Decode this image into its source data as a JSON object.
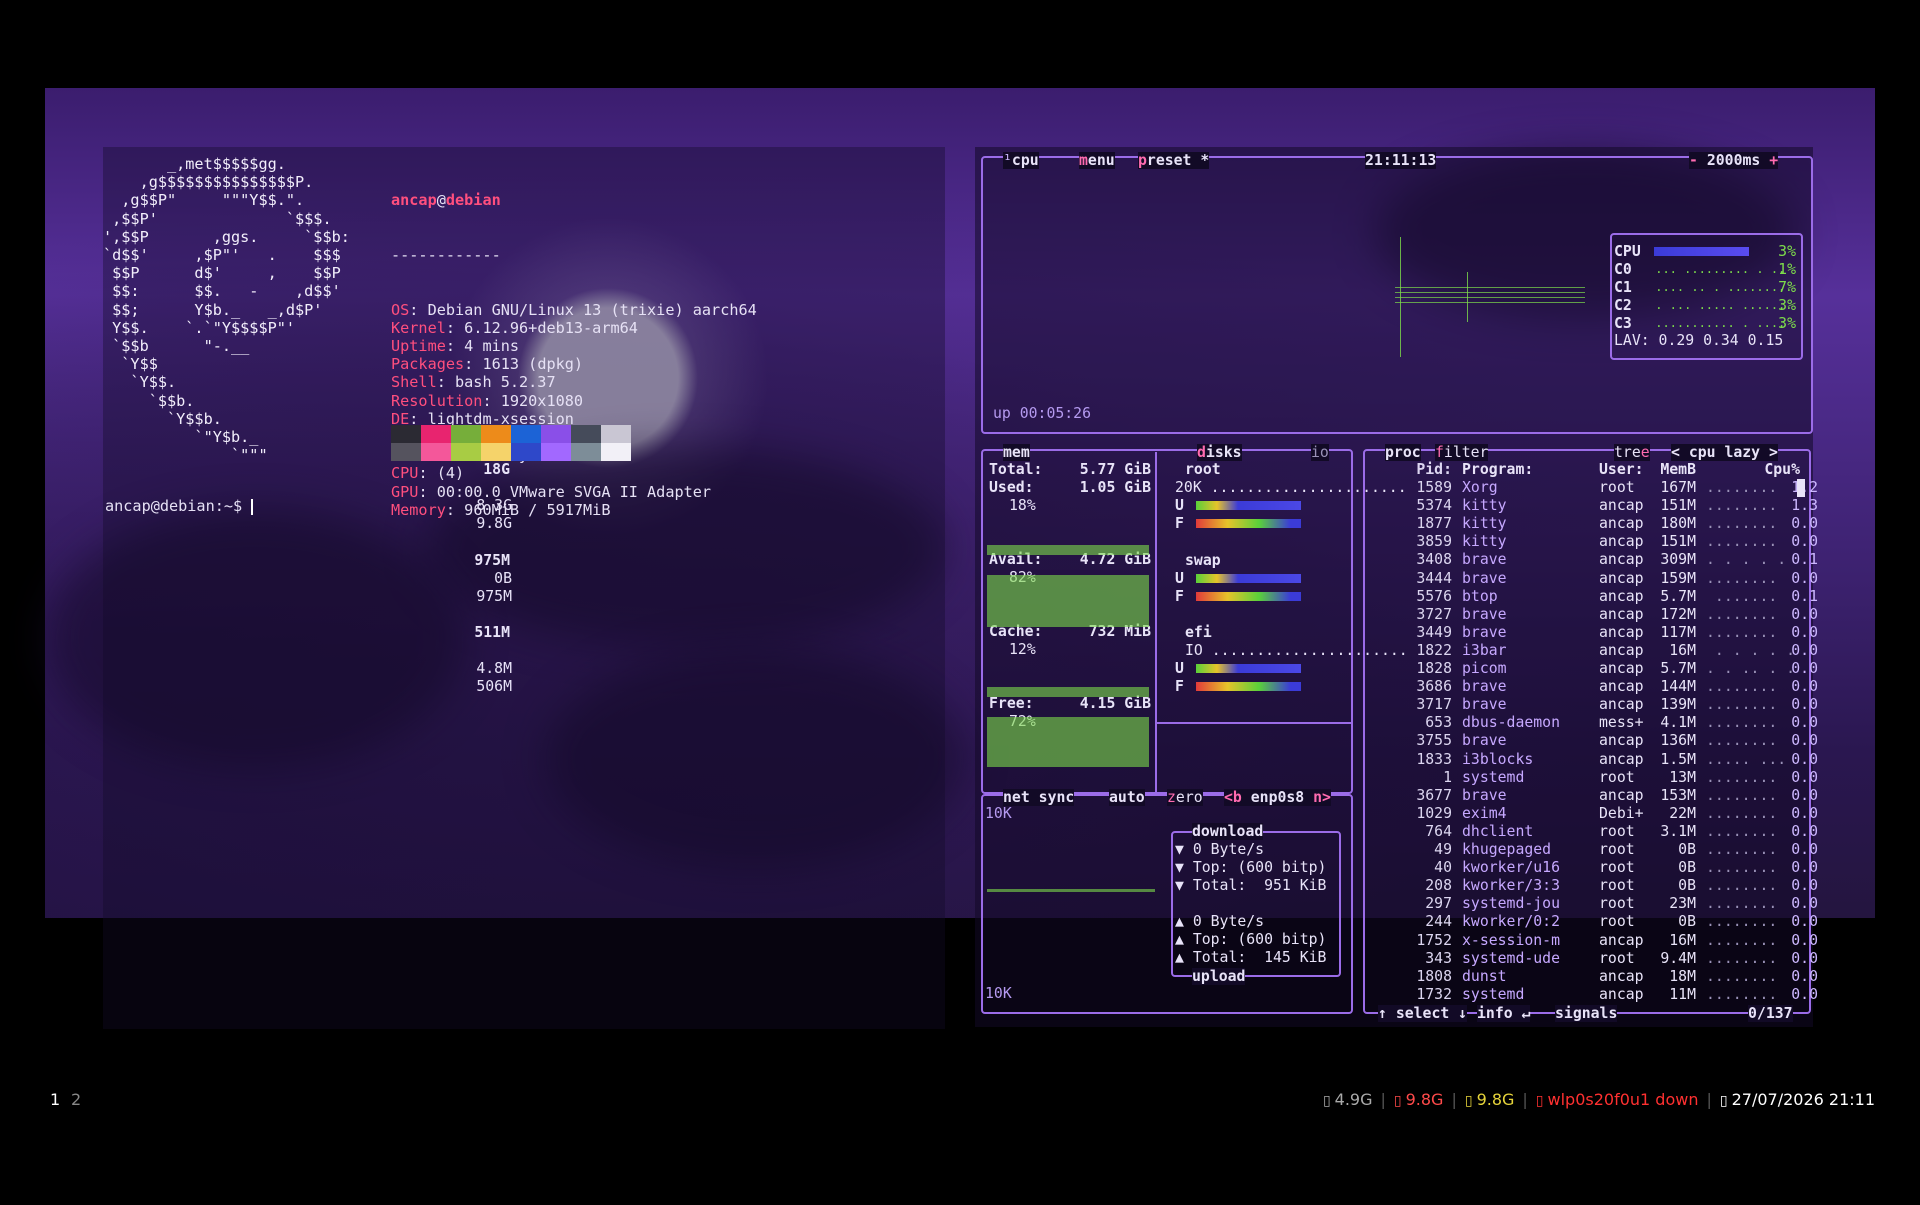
{
  "terminal": {
    "logo_lines": [
      "       _,met$$$$$gg.",
      "    ,g$$$$$$$$$$$$$$$P.",
      "  ,g$$P\"     \"\"\"Y$$.\".",
      " ,$$P'              `$$$.",
      "',$$P       ,ggs.     `$$b:",
      "`d$$'     ,$P\"'   .    $$$",
      " $$P      d$'     ,    $$P",
      " $$:      $$.   -    ,d$$'",
      " $$;      Y$b._   _,d$P'",
      " Y$$.    `.`\"Y$$$$P\"'",
      " `$$b      \"-.__",
      "  `Y$$",
      "   `Y$$.",
      "     `$$b.",
      "       `Y$$b.",
      "          `\"Y$b._",
      "              `\"\"\""
    ],
    "user": "ancap",
    "at": "@",
    "host": "debian",
    "separator": "------------",
    "info": [
      {
        "key": "OS",
        "value": "Debian GNU/Linux 13 (trixie) aarch64"
      },
      {
        "key": "Kernel",
        "value": "6.12.96+deb13-arm64"
      },
      {
        "key": "Uptime",
        "value": "4 mins"
      },
      {
        "key": "Packages",
        "value": "1613 (dpkg)"
      },
      {
        "key": "Shell",
        "value": "bash 5.2.37"
      },
      {
        "key": "Resolution",
        "value": "1920x1080"
      },
      {
        "key": "DE",
        "value": "lightdm-xsession"
      },
      {
        "key": "WM",
        "value": "i3"
      },
      {
        "key": "Terminal",
        "value": "kitty"
      },
      {
        "key": "CPU",
        "value": "(4)"
      },
      {
        "key": "GPU",
        "value": "00:00.0 VMware SVGA II Adapter"
      },
      {
        "key": "Memory",
        "value": "960MiB / 5917MiB"
      }
    ],
    "palette_top": [
      "#2b2a33",
      "#e8246f",
      "#76ae3a",
      "#ed8b1a",
      "#1c63d6",
      "#8a4fe8",
      "#454b5a",
      "#c9c6d3"
    ],
    "palette_bottom": [
      "#55535e",
      "#f4579a",
      "#a8cc44",
      "#f5d36a",
      "#2e48c9",
      "#a268ff",
      "#7d8d98",
      "#f2f0f7"
    ],
    "prompt": "ancap@debian:~$ "
  },
  "btop": {
    "cpu_box": {
      "tab_num": "¹",
      "tab_cpu": "cpu",
      "menu_m": "m",
      "menu_rest": "enu",
      "preset_p": "p",
      "preset_rest": "reset *",
      "clock": "21:11:13",
      "minus": "-",
      "interval": "2000ms",
      "plus": "+",
      "uptime": "up 00:05:26",
      "cores": [
        {
          "label": "CPU",
          "pct": "3%",
          "dots": ""
        },
        {
          "label": "C0",
          "pct": "1%",
          "dots": " ... ......... . .."
        },
        {
          "label": "C1",
          "pct": "7%",
          "dots": " .... .. . ........."
        },
        {
          "label": "C2",
          "pct": "3%",
          "dots": " . ... ..... ......."
        },
        {
          "label": "C3",
          "pct": "3%",
          "dots": " ........... . ...."
        }
      ],
      "lav": "LAV: 0.29 0.34 0.15"
    },
    "mem_box": {
      "tab": "mem",
      "rows": [
        {
          "label": "Total:",
          "value": "5.77 GiB"
        },
        {
          "label": "Used:",
          "value": "1.05 GiB",
          "pct": "18%"
        },
        {
          "label": "Avail:",
          "value": "4.72 GiB",
          "pct": "82%"
        },
        {
          "label": "Cache:",
          "value": "732 MiB",
          "pct": "12%"
        },
        {
          "label": "Free:",
          "value": "4.15 GiB",
          "pct": "72%"
        }
      ]
    },
    "disks_box": {
      "tab_d": "d",
      "tab_rest": "isks",
      "tab_io": "io",
      "disks": [
        {
          "name": "root",
          "size": "18G",
          "io": "20K",
          "used": "8.3G",
          "free": "9.8G"
        },
        {
          "name": "swap",
          "size": "975M",
          "io": "",
          "used": "0B",
          "free": "975M"
        },
        {
          "name": "efi",
          "size": "511M",
          "io": "IO",
          "used": "4.8M",
          "free": "506M"
        }
      ],
      "u": "U",
      "f": "F"
    },
    "net_box": {
      "tab": "net",
      "sync": "sync",
      "auto": "auto",
      "zero_z": "z",
      "zero_rest": "ero",
      "iface_left": "<b",
      "iface": "enp0s8",
      "iface_right": "n>",
      "scale_top": "10K",
      "scale_bottom": "10K",
      "download_title": "download",
      "download": [
        "▼ 0 Byte/s",
        "▼ Top: (600 bitp)",
        "▼ Total:  951 KiB"
      ],
      "upload": [
        "▲ 0 Byte/s",
        "▲ Top: (600 bitp)",
        "▲ Total:  145 KiB"
      ],
      "upload_title": "upload"
    },
    "proc_box": {
      "tab": "proc",
      "filter_f": "f",
      "filter_rest": "ilter",
      "tree_rest": "tre",
      "tree_e": "e",
      "sort": "< cpu lazy >",
      "headers": {
        "pid": "Pid:",
        "program": "Program:",
        "user": "User:",
        "mem": "MemB",
        "cpu": "Cpu%"
      },
      "rows": [
        {
          "pid": "1589",
          "program": "Xorg",
          "user": "root",
          "mem": "167M",
          "spark": "........",
          "cpu": "1.2"
        },
        {
          "pid": "5374",
          "program": "kitty",
          "user": "ancap",
          "mem": "151M",
          "spark": "........",
          "cpu": "1.3"
        },
        {
          "pid": "1877",
          "program": "kitty",
          "user": "ancap",
          "mem": "180M",
          "spark": "........",
          "cpu": "0.0"
        },
        {
          "pid": "3859",
          "program": "kitty",
          "user": "ancap",
          "mem": "151M",
          "spark": "........",
          "cpu": "0.0"
        },
        {
          "pid": "3408",
          "program": "brave",
          "user": "ancap",
          "mem": "309M",
          "spark": ". . . . .",
          "cpu": "0.1"
        },
        {
          "pid": "3444",
          "program": "brave",
          "user": "ancap",
          "mem": "159M",
          "spark": "........",
          "cpu": "0.0"
        },
        {
          "pid": "5576",
          "program": "btop",
          "user": "ancap",
          "mem": "5.7M",
          "spark": " .......",
          "cpu": "0.1"
        },
        {
          "pid": "3727",
          "program": "brave",
          "user": "ancap",
          "mem": "172M",
          "spark": "........",
          "cpu": "0.0"
        },
        {
          "pid": "3449",
          "program": "brave",
          "user": "ancap",
          "mem": "117M",
          "spark": "........",
          "cpu": "0.0"
        },
        {
          "pid": "1822",
          "program": "i3bar",
          "user": "ancap",
          "mem": "16M",
          "spark": " . . . . .",
          "cpu": "0.0"
        },
        {
          "pid": "1828",
          "program": "picom",
          "user": "ancap",
          "mem": "5.7M",
          "spark": ". . .. . .",
          "cpu": "0.0"
        },
        {
          "pid": "3686",
          "program": "brave",
          "user": "ancap",
          "mem": "144M",
          "spark": "........",
          "cpu": "0.0"
        },
        {
          "pid": "3717",
          "program": "brave",
          "user": "ancap",
          "mem": "139M",
          "spark": "........",
          "cpu": "0.0"
        },
        {
          "pid": "653",
          "program": "dbus-daemon",
          "user": "mess+",
          "mem": "4.1M",
          "spark": "........",
          "cpu": "0.0"
        },
        {
          "pid": "3755",
          "program": "brave",
          "user": "ancap",
          "mem": "136M",
          "spark": "........",
          "cpu": "0.0"
        },
        {
          "pid": "1833",
          "program": "i3blocks",
          "user": "ancap",
          "mem": "1.5M",
          "spark": "..... ...",
          "cpu": "0.0"
        },
        {
          "pid": "1",
          "program": "systemd",
          "user": "root",
          "mem": "13M",
          "spark": "........",
          "cpu": "0.0"
        },
        {
          "pid": "3677",
          "program": "brave",
          "user": "ancap",
          "mem": "153M",
          "spark": "........",
          "cpu": "0.0"
        },
        {
          "pid": "1029",
          "program": "exim4",
          "user": "Debi+",
          "mem": "22M",
          "spark": "........",
          "cpu": "0.0"
        },
        {
          "pid": "764",
          "program": "dhclient",
          "user": "root",
          "mem": "3.1M",
          "spark": "........",
          "cpu": "0.0"
        },
        {
          "pid": "49",
          "program": "khugepaged",
          "user": "root",
          "mem": "0B",
          "spark": "........",
          "cpu": "0.0"
        },
        {
          "pid": "40",
          "program": "kworker/u16",
          "user": "root",
          "mem": "0B",
          "spark": "........",
          "cpu": "0.0"
        },
        {
          "pid": "208",
          "program": "kworker/3:3",
          "user": "root",
          "mem": "0B",
          "spark": "........",
          "cpu": "0.0"
        },
        {
          "pid": "297",
          "program": "systemd-jou",
          "user": "root",
          "mem": "23M",
          "spark": "........",
          "cpu": "0.0"
        },
        {
          "pid": "244",
          "program": "kworker/0:2",
          "user": "root",
          "mem": "0B",
          "spark": "........",
          "cpu": "0.0"
        },
        {
          "pid": "1752",
          "program": "x-session-m",
          "user": "ancap",
          "mem": "16M",
          "spark": "........",
          "cpu": "0.0"
        },
        {
          "pid": "343",
          "program": "systemd-ude",
          "user": "root",
          "mem": "9.4M",
          "spark": "........",
          "cpu": "0.0"
        },
        {
          "pid": "1808",
          "program": "dunst",
          "user": "ancap",
          "mem": "18M",
          "spark": "........",
          "cpu": "0.0"
        },
        {
          "pid": "1732",
          "program": "systemd",
          "user": "ancap",
          "mem": "11M",
          "spark": "........",
          "cpu": "0.0"
        }
      ],
      "footer_select": "↑ select ↓",
      "footer_info": "info ↵",
      "footer_signals": "signals",
      "count": "0/137"
    }
  },
  "i3bar": {
    "workspaces": [
      "1",
      "2"
    ],
    "blocks": [
      {
        "icon": "disk-icon",
        "text": "4.9G",
        "color": "#aaaaaa"
      },
      {
        "icon": "disk-icon",
        "text": "9.8G",
        "color": "#ff4a4a"
      },
      {
        "icon": "disk-icon",
        "text": "9.8G",
        "color": "#e6d43a"
      },
      {
        "icon": "wifi-icon",
        "text": "wlp0s20f0u1 down",
        "color": "#ff3030"
      },
      {
        "icon": "calendar-icon",
        "text": "27/07/2026 21:11",
        "color": "#ffffff"
      }
    ]
  }
}
